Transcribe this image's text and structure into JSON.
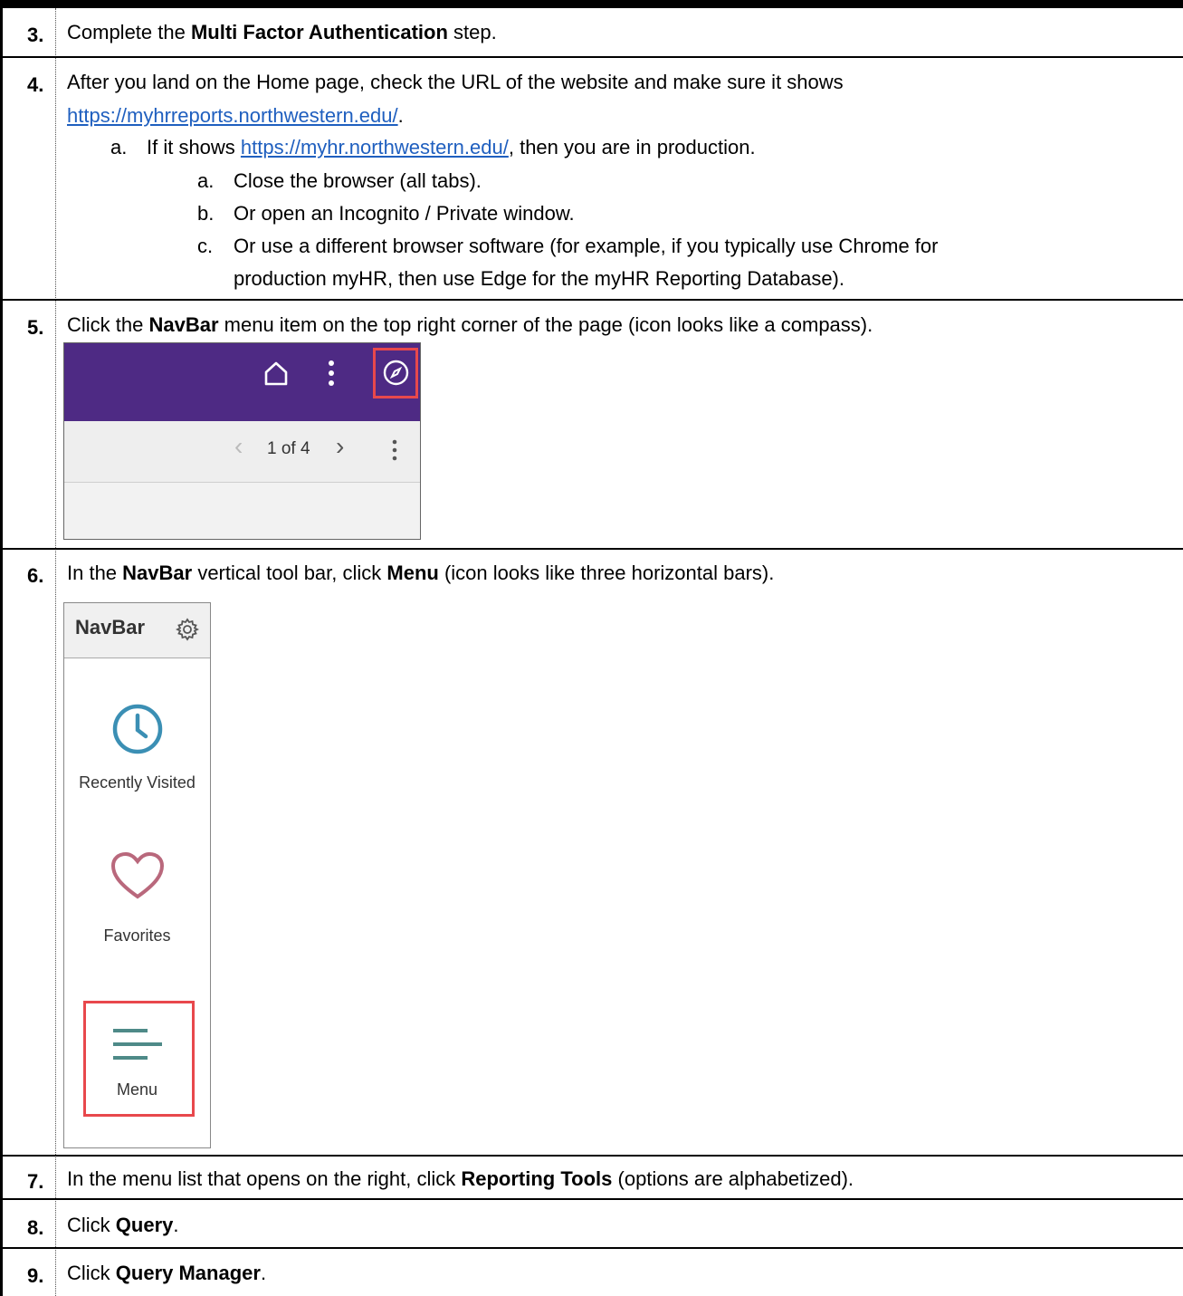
{
  "steps": [
    {
      "num": "3.",
      "lines": [
        {
          "parts": [
            {
              "t": "Complete the "
            },
            {
              "b": "Multi Factor Authentication"
            },
            {
              "t": " step."
            }
          ]
        }
      ]
    },
    {
      "num": "4.",
      "intro1": "After you land on the Home page, check the URL of the website and make sure it shows",
      "intro_link": "https://myhrreports.northwestern.edu/",
      "intro_end": ".",
      "sub_a_marker": "a.",
      "sub_a_pre": "If it shows ",
      "sub_a_link": "https://myhr.northwestern.edu/",
      "sub_a_post": ", then you are in production.",
      "subsub": [
        {
          "marker": "a.",
          "text": "Close the browser (all tabs)."
        },
        {
          "marker": "b.",
          "text": "Or open an Incognito / Private window."
        },
        {
          "marker": "c.",
          "text": "Or use a different browser software (for example, if you typically use Chrome for",
          "text2": "production myHR, then use Edge for the myHR Reporting Database)."
        }
      ]
    },
    {
      "num": "5.",
      "pre": "Click the ",
      "bold": "NavBar",
      "post": " menu item on the top right corner of the page (icon looks like a compass)."
    },
    {
      "num": "6.",
      "pre": "In the ",
      "bold": "NavBar",
      "mid": " vertical tool bar, click ",
      "bold2": "Menu",
      "post": " (icon looks like three horizontal bars)."
    },
    {
      "num": "7.",
      "pre": "In the menu list that opens on the right, click ",
      "bold": "Reporting Tools",
      "post": " (options are alphabetized)."
    },
    {
      "num": "8.",
      "pre": "Click ",
      "bold": "Query",
      "post": "."
    },
    {
      "num": "9.",
      "pre": "Click ",
      "bold": "Query Manager",
      "post": "."
    }
  ],
  "shot1": {
    "pager_text": "1 of 4",
    "prev_glyph": "‹",
    "next_glyph": "›"
  },
  "shot2": {
    "header": "NavBar",
    "items": [
      "Recently Visited",
      "Favorites",
      "Menu"
    ]
  },
  "colors": {
    "purple": "#4e2a84",
    "highlight": "#e8484c",
    "clock": "#3b8fb4",
    "heart": "#b9687c",
    "menu": "#4e8a88"
  }
}
